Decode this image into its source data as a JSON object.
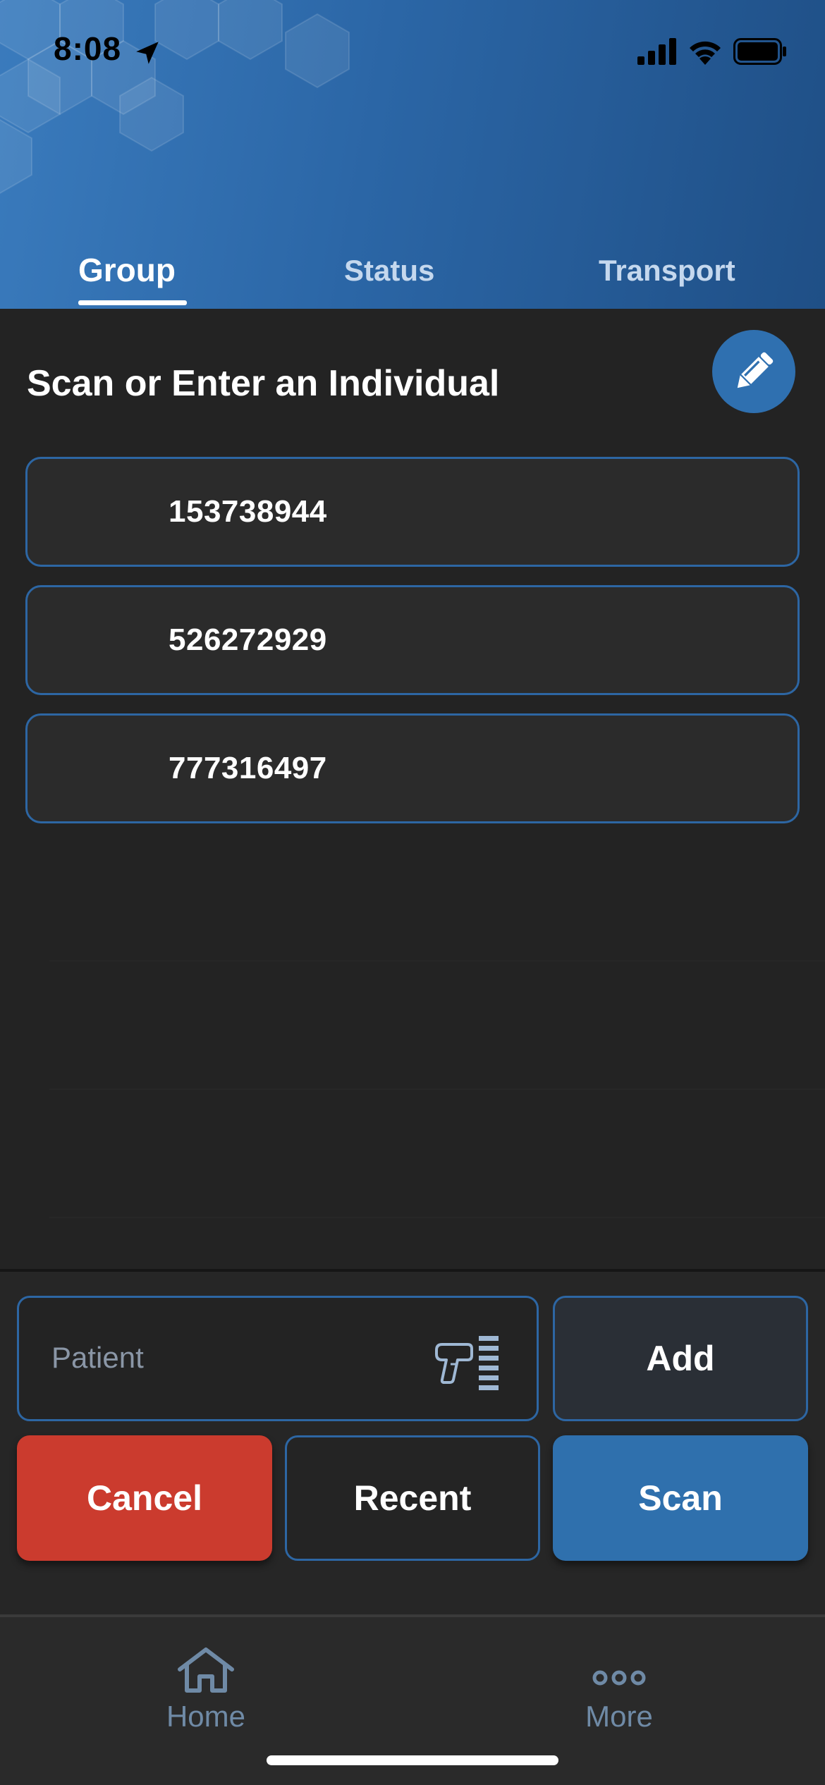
{
  "status_bar": {
    "time": "8:08"
  },
  "tabs": [
    {
      "label": "Group",
      "active": true
    },
    {
      "label": "Status",
      "active": false
    },
    {
      "label": "Transport",
      "active": false
    }
  ],
  "main": {
    "title": "Scan or Enter an Individual",
    "individuals": [
      "153738944",
      "526272929",
      "777316497"
    ]
  },
  "actions": {
    "patient_placeholder": "Patient",
    "add_label": "Add",
    "cancel_label": "Cancel",
    "recent_label": "Recent",
    "scan_label": "Scan"
  },
  "bottom_nav": {
    "home_label": "Home",
    "more_label": "More"
  },
  "colors": {
    "accent": "#2f70b0",
    "cancel": "#cb3b2e",
    "background": "#232323",
    "border": "#2d66a3"
  },
  "icons": [
    "location-arrow-icon",
    "cellular-signal-icon",
    "wifi-icon",
    "battery-icon",
    "pencil-icon",
    "barcode-scanner-icon",
    "home-icon",
    "more-dots-icon"
  ]
}
